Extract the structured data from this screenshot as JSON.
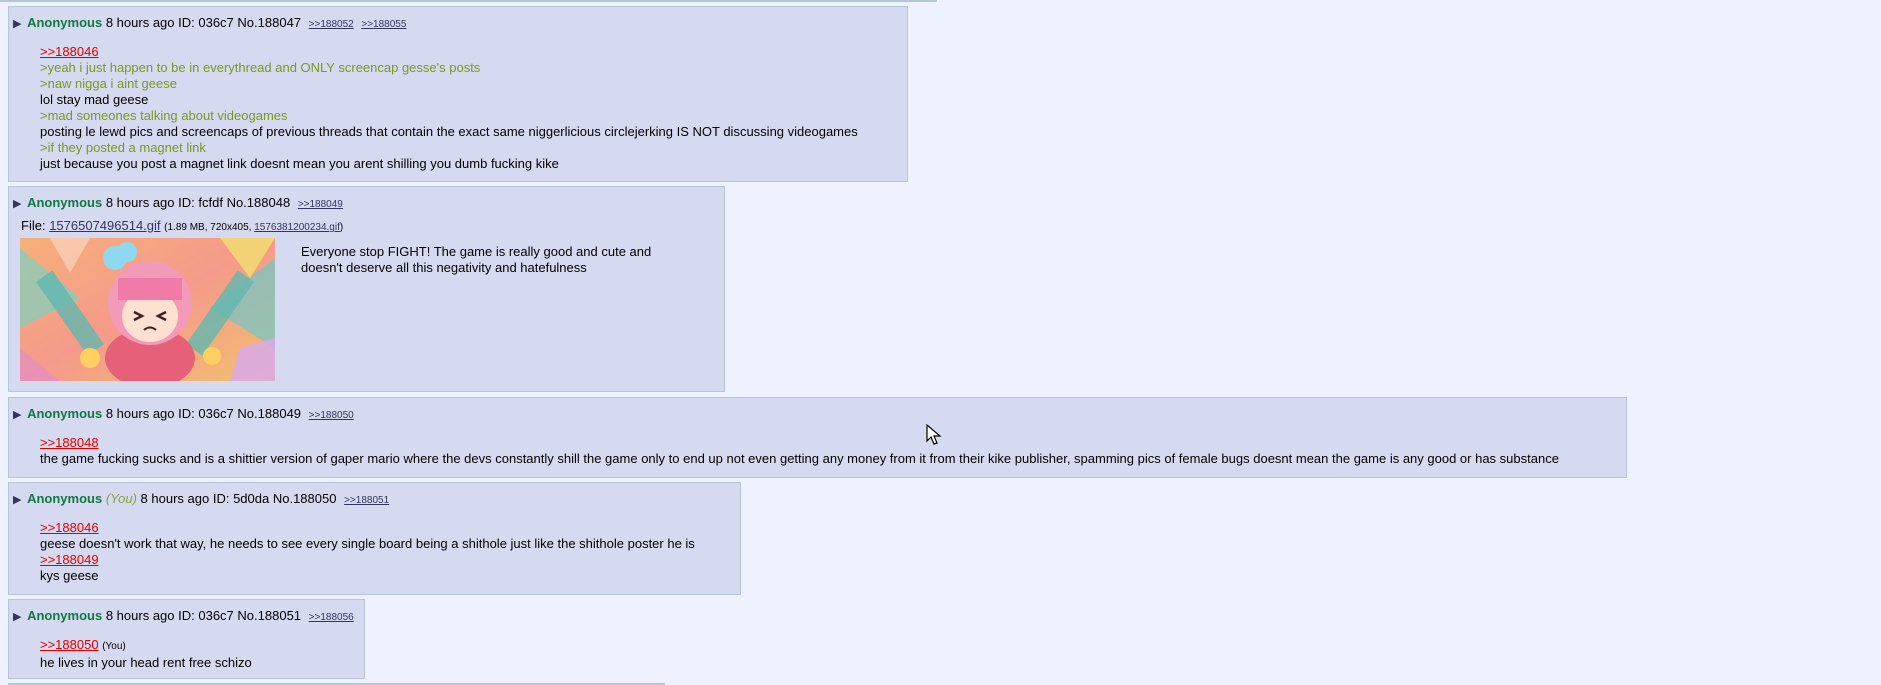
{
  "posts": [
    {
      "name": "Anonymous",
      "time": "8 hours ago",
      "id": "ID: 036c7",
      "no": "No.188047",
      "replies": [
        ">>188052",
        ">>188055"
      ],
      "lines": [
        {
          "type": "quote",
          "text": ">>188046"
        },
        {
          "type": "green",
          "text": ">yeah i just happen to be in everythread and ONLY screencap gesse's posts"
        },
        {
          "type": "green",
          "text": ">naw nigga i aint geese"
        },
        {
          "type": "text",
          "text": "lol stay mad geese"
        },
        {
          "type": "green",
          "text": ">mad someones talking about videogames"
        },
        {
          "type": "text",
          "text": "posting le lewd pics and screencaps of previous threads that contain the exact same niggerlicious circlejerking IS NOT discussing videogames"
        },
        {
          "type": "green",
          "text": ">if they posted a magnet link"
        },
        {
          "type": "text",
          "text": "just because you post a magnet link doesnt mean you arent shilling you dumb fucking kike"
        }
      ]
    },
    {
      "name": "Anonymous",
      "time": "8 hours ago",
      "id": "ID: fcfdf",
      "no": "No.188048",
      "replies": [
        ">>188049"
      ],
      "file": {
        "label": "File:",
        "filename": "1576507496514.gif",
        "meta_open": "(1.89 MB, 720x405,",
        "original": "1576381200234.gif",
        "meta_close": ")"
      },
      "lines": [
        {
          "type": "text",
          "text": "Everyone stop FIGHT! The game is really good and cute and"
        },
        {
          "type": "text",
          "text": "doesn't deserve all this negativity and hatefulness"
        }
      ]
    },
    {
      "name": "Anonymous",
      "time": "8 hours ago",
      "id": "ID: 036c7",
      "no": "No.188049",
      "replies": [
        ">>188050"
      ],
      "lines": [
        {
          "type": "quote",
          "text": ">>188048"
        },
        {
          "type": "text",
          "text": "the game fucking sucks and is a shittier version of gaper mario where the devs constantly shill the game only to end up not even getting any money from it from their kike publisher, spamming pics of female bugs doesnt mean the game is any good or has substance"
        }
      ]
    },
    {
      "name": "Anonymous",
      "you": "(You)",
      "time": "8 hours ago",
      "id": "ID: 5d0da",
      "no": "No.188050",
      "replies": [
        ">>188051"
      ],
      "lines": [
        {
          "type": "quote",
          "text": ">>188046"
        },
        {
          "type": "text",
          "text": "geese doesn't work that way, he needs to see every single board being a shithole just like the shithole poster he is"
        },
        {
          "type": "quote",
          "text": ">>188049"
        },
        {
          "type": "text",
          "text": "kys geese"
        }
      ]
    },
    {
      "name": "Anonymous",
      "time": "8 hours ago",
      "id": "ID: 036c7",
      "no": "No.188051",
      "replies": [
        ">>188056"
      ],
      "lines": [
        {
          "type": "quote",
          "text": ">>188050",
          "suffix": "(You)"
        },
        {
          "type": "text",
          "text": "he lives in your head rent free schizo"
        }
      ]
    }
  ]
}
